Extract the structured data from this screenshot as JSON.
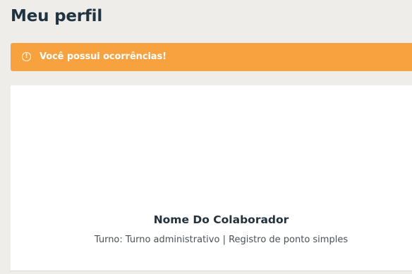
{
  "page": {
    "title": "Meu perfil"
  },
  "alert": {
    "icon": "info-icon",
    "icon_glyph": "!",
    "message": "Você possui ocorrências!",
    "color": "#f7a23e"
  },
  "profile": {
    "name": "Nome Do Colaborador",
    "shift_line": "Turno: Turno administrativo | Registro de ponto simples"
  }
}
